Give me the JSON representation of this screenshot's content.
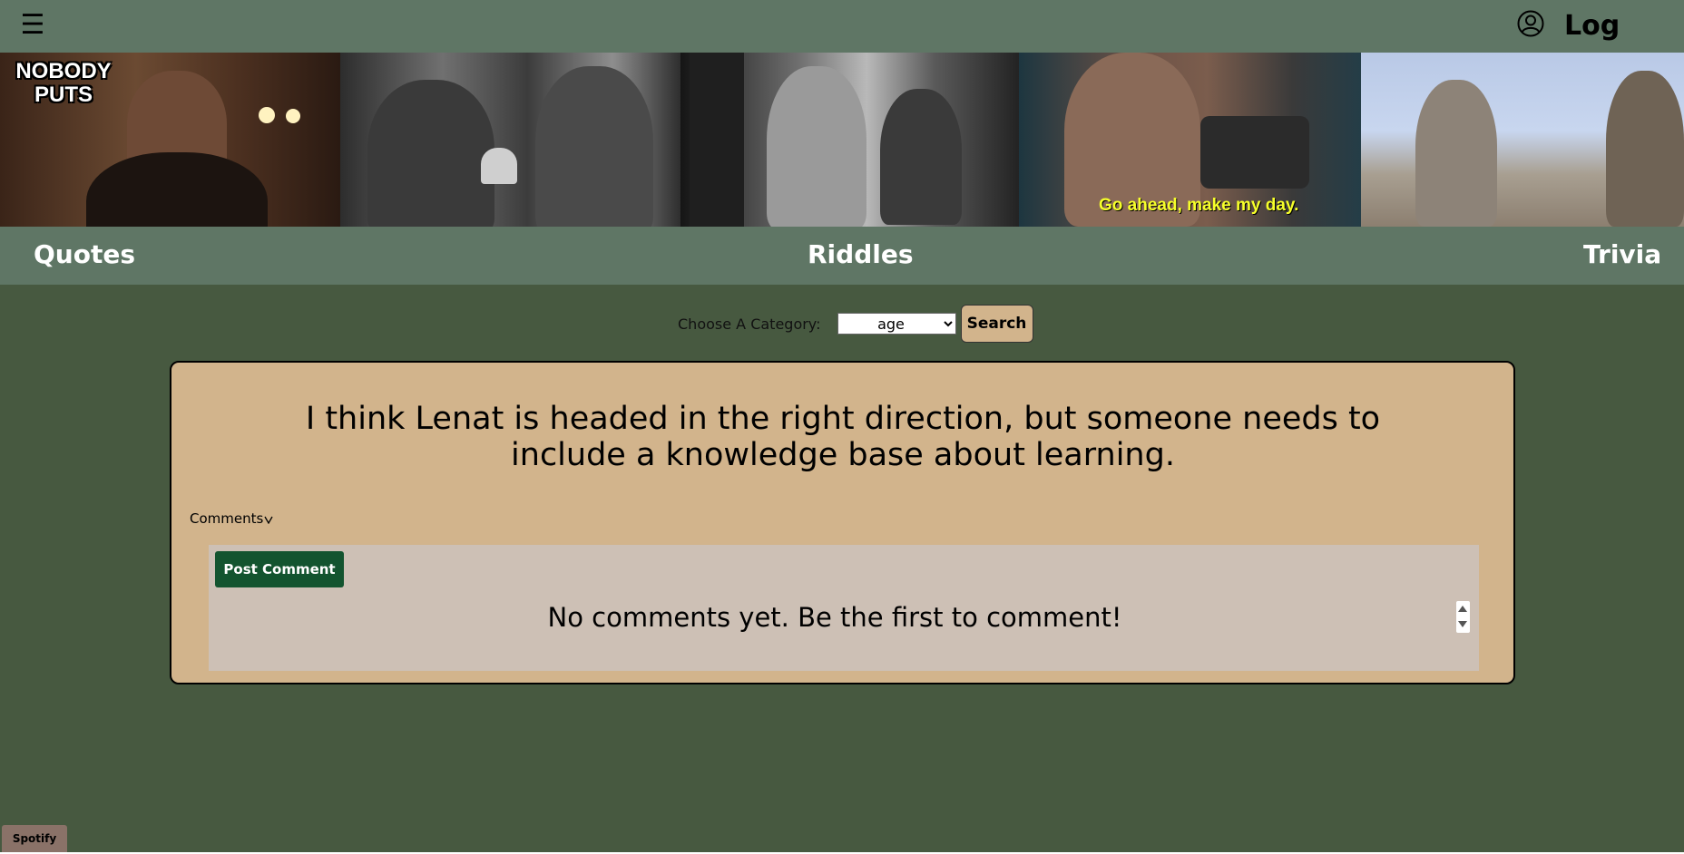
{
  "header": {
    "menu_icon": "hamburger-icon",
    "menu_glyph": "☰",
    "user_icon": "user-circle-icon",
    "logout_label": "Log Out"
  },
  "banner": {
    "panel1_caption": "NOBODY PUTS",
    "panel4_caption": "Go ahead, make my day."
  },
  "nav": {
    "items": [
      {
        "label": "Quotes"
      },
      {
        "label": "Riddles"
      },
      {
        "label": "Trivia"
      }
    ]
  },
  "filter": {
    "label": "Choose A Category:",
    "selected": "age",
    "button_label": "Search"
  },
  "card": {
    "quote": "I think Lenat is headed in the right direction, but someone needs to include a knowledge base about learning.",
    "comments_toggle": "Comments",
    "post_comment_label": "Post Comment",
    "empty_message": "No comments yet. Be the first to comment!"
  },
  "footer": {
    "spotify_label": "Spotify"
  },
  "colors": {
    "header_bg": "#5f7665",
    "page_bg": "#475940",
    "card_bg": "#d2b48c",
    "comments_bg": "#cdc0b5",
    "post_button_bg": "#13542f"
  }
}
